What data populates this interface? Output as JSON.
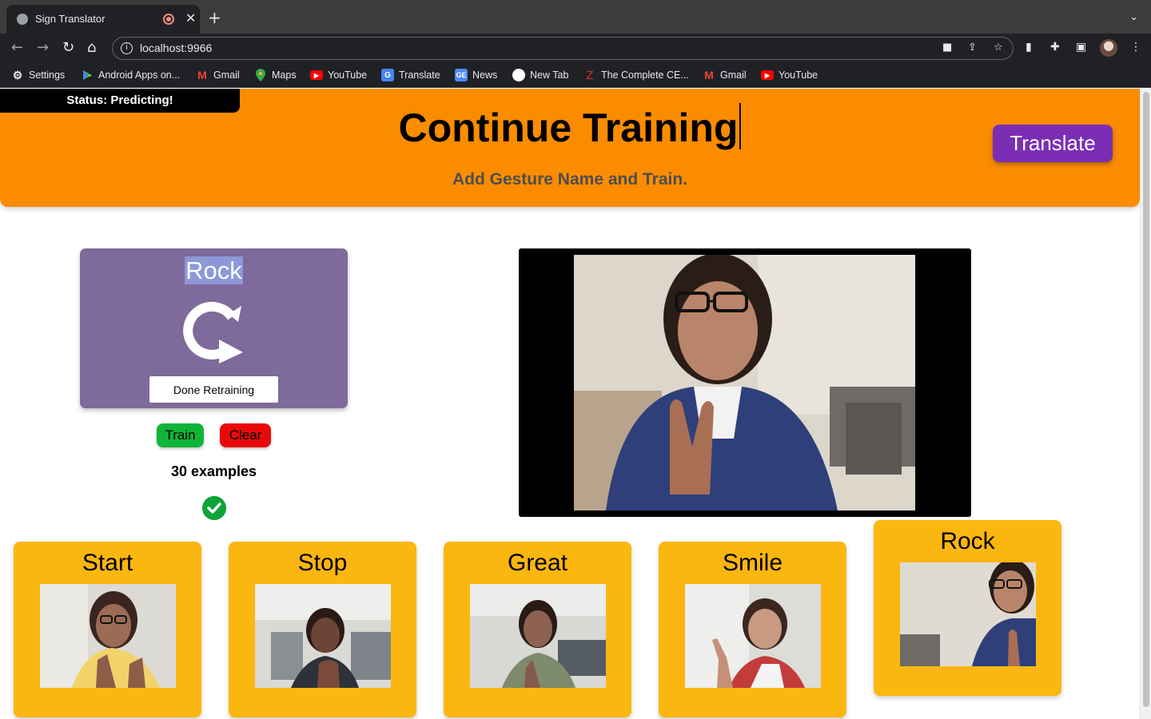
{
  "browser": {
    "tab_title": "Sign Translator",
    "url": "localhost:9966",
    "bookmarks": [
      {
        "label": "Settings",
        "icon": "gear-icon"
      },
      {
        "label": "Android Apps on...",
        "icon": "play-store-icon"
      },
      {
        "label": "Gmail",
        "icon": "gmail-icon"
      },
      {
        "label": "Maps",
        "icon": "maps-icon"
      },
      {
        "label": "YouTube",
        "icon": "youtube-icon"
      },
      {
        "label": "Translate",
        "icon": "translate-icon"
      },
      {
        "label": "News",
        "icon": "news-icon"
      },
      {
        "label": "New Tab",
        "icon": "new-tab-icon"
      },
      {
        "label": "The Complete CE...",
        "icon": "z-icon"
      },
      {
        "label": "Gmail",
        "icon": "gmail-icon"
      },
      {
        "label": "YouTube",
        "icon": "youtube-icon"
      }
    ]
  },
  "status": "Status: Predicting!",
  "header": {
    "title": "Continue Training",
    "subtitle": "Add Gesture Name and Train.",
    "translate_label": "Translate"
  },
  "training_card": {
    "gesture_name": "Rock",
    "done_label": "Done Retraining",
    "train_label": "Train",
    "clear_label": "Clear",
    "examples_text": "30 examples"
  },
  "gestures": [
    {
      "name": "Start"
    },
    {
      "name": "Stop"
    },
    {
      "name": "Great"
    },
    {
      "name": "Smile"
    },
    {
      "name": "Rock"
    }
  ],
  "colors": {
    "header": "#fb8c00",
    "translate_button": "#7b2eb3",
    "training_card": "#7e6a9b",
    "gesture_card": "#fbb60f",
    "train_button": "#10b438",
    "clear_button": "#e80a0a",
    "check": "#0fa33a"
  }
}
